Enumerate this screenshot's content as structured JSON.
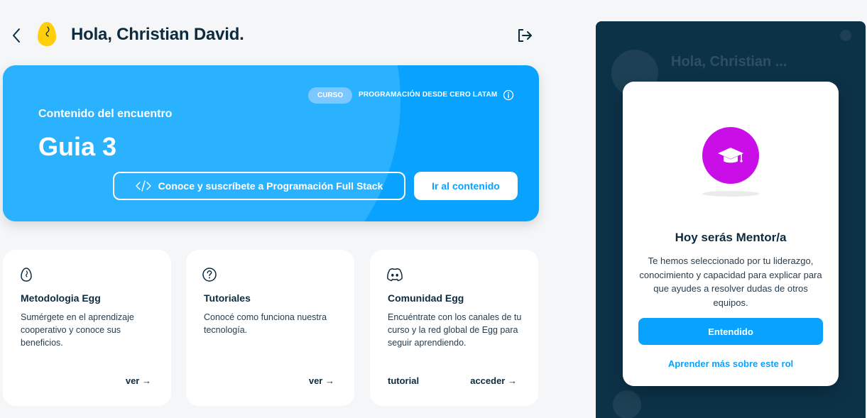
{
  "header": {
    "greeting": "Hola, Christian David."
  },
  "hero": {
    "badge": "CURSO",
    "course_name": "PROGRAMACIÓN DESDE CERO LATAM",
    "subtitle": "Contenido del encuentro",
    "title": "Guia 3",
    "subscribe_button": "Conoce y suscríbete a Programación Full Stack",
    "content_button": "Ir al contenido"
  },
  "cards": [
    {
      "icon": "egg-icon",
      "title": "Metodologia Egg",
      "description": "Sumérgete en el aprendizaje cooperativo y conoce sus beneficios.",
      "link": "ver"
    },
    {
      "icon": "help-circle-icon",
      "title": "Tutoriales",
      "description": "Conocé como funciona nuestra tecnología.",
      "link": "ver"
    },
    {
      "icon": "discord-icon",
      "title": "Comunidad Egg",
      "description": "Encuéntrate con los canales de tu curso y la red global de Egg para seguir aprendiendo.",
      "secondary_link": "tutorial",
      "link": "acceder"
    }
  ],
  "side_panel": {
    "ghost_greeting": "Hola, Christian ..."
  },
  "modal": {
    "icon": "graduation-cap-icon",
    "title": "Hoy serás Mentor/a",
    "text": "Te hemos seleccionado por tu liderazgo, conocimiento y capacidad para explicar para que ayudes a resolver dudas de otros equipos.",
    "primary_button": "Entendido",
    "secondary_link": "Aprender más sobre este rol"
  },
  "colors": {
    "accent": "#0aa2ff",
    "dark": "#0c3248",
    "mentor": "#c90ee8",
    "logo": "#ffcf0a"
  }
}
